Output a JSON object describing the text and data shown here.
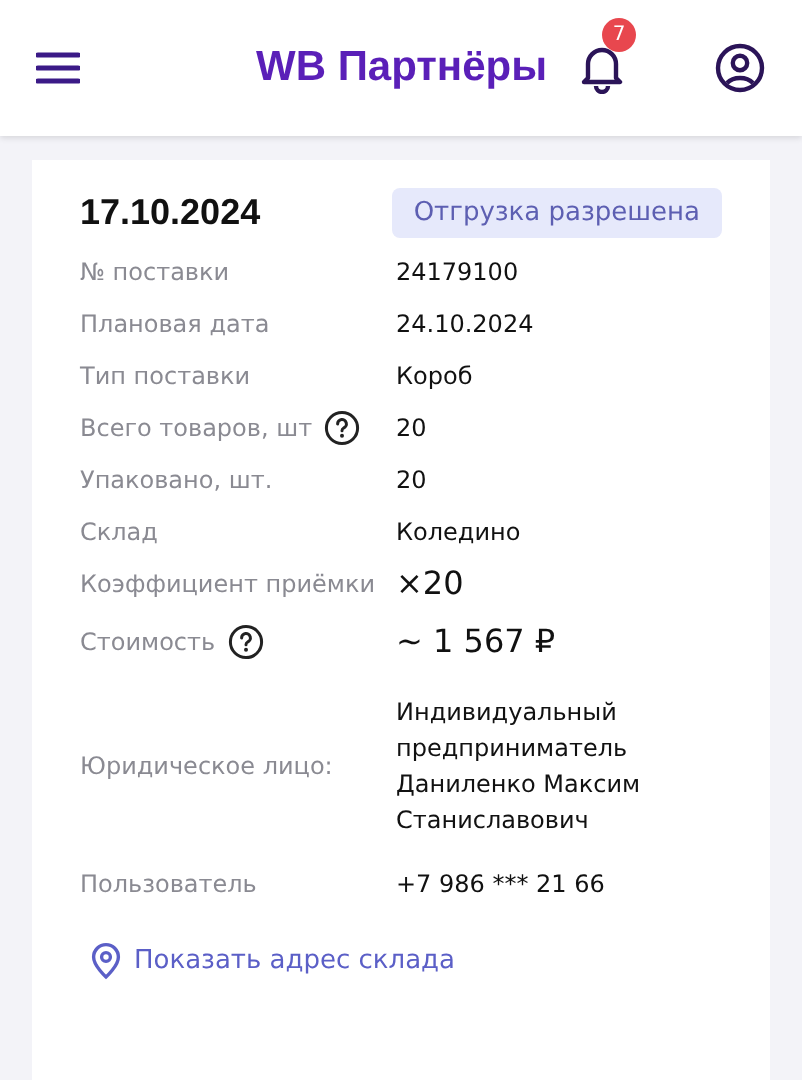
{
  "header": {
    "title": "WB Партнёры",
    "notification_count": "7"
  },
  "supply": {
    "date": "17.10.2024",
    "status": "Отгрузка разрешена",
    "rows": [
      {
        "label": "№ поставки",
        "value": "24179100",
        "help": false,
        "kind": "plain"
      },
      {
        "label": "Плановая дата",
        "value": "24.10.2024",
        "help": false,
        "kind": "plain"
      },
      {
        "label": "Тип поставки",
        "value": "Короб",
        "help": false,
        "kind": "plain"
      },
      {
        "label": "Всего товаров, шт",
        "value": "20",
        "help": true,
        "kind": "plain"
      },
      {
        "label": "Упаковано, шт.",
        "value": "20",
        "help": false,
        "kind": "plain"
      },
      {
        "label": "Склад",
        "value": "Коледино",
        "help": false,
        "kind": "plain"
      },
      {
        "label": "Коэффициент приёмки",
        "value": "×20",
        "help": false,
        "kind": "large"
      },
      {
        "label": "Стоимость",
        "value": "~ 1 567 ₽",
        "help": true,
        "kind": "large"
      },
      {
        "label": "Юридическое лицо:",
        "value": "Индивидуальный предприниматель Даниленко Максим Станиславович",
        "help": false,
        "kind": "plain"
      },
      {
        "label": "Пользователь",
        "value": "+7 986 *** 21 66",
        "help": false,
        "kind": "plain"
      }
    ],
    "address_link": "Показать адрес склада"
  }
}
